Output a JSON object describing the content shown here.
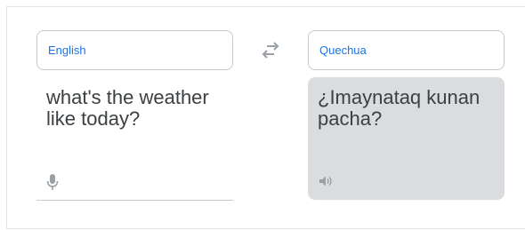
{
  "source": {
    "language_label": "English",
    "text": "what's the weather\nlike today?",
    "mic_icon": "microphone-icon"
  },
  "swap": {
    "icon": "swap-languages-icon"
  },
  "target": {
    "language_label": "Quechua",
    "text": "¿Imaynataq kunan\npacha?",
    "speaker_icon": "speaker-icon"
  },
  "colors": {
    "accent": "#1a73e8",
    "text": "#3c4043",
    "target_panel_bg": "#dadce0",
    "border": "#c9cbcf",
    "icon": "#9aa0a6"
  }
}
